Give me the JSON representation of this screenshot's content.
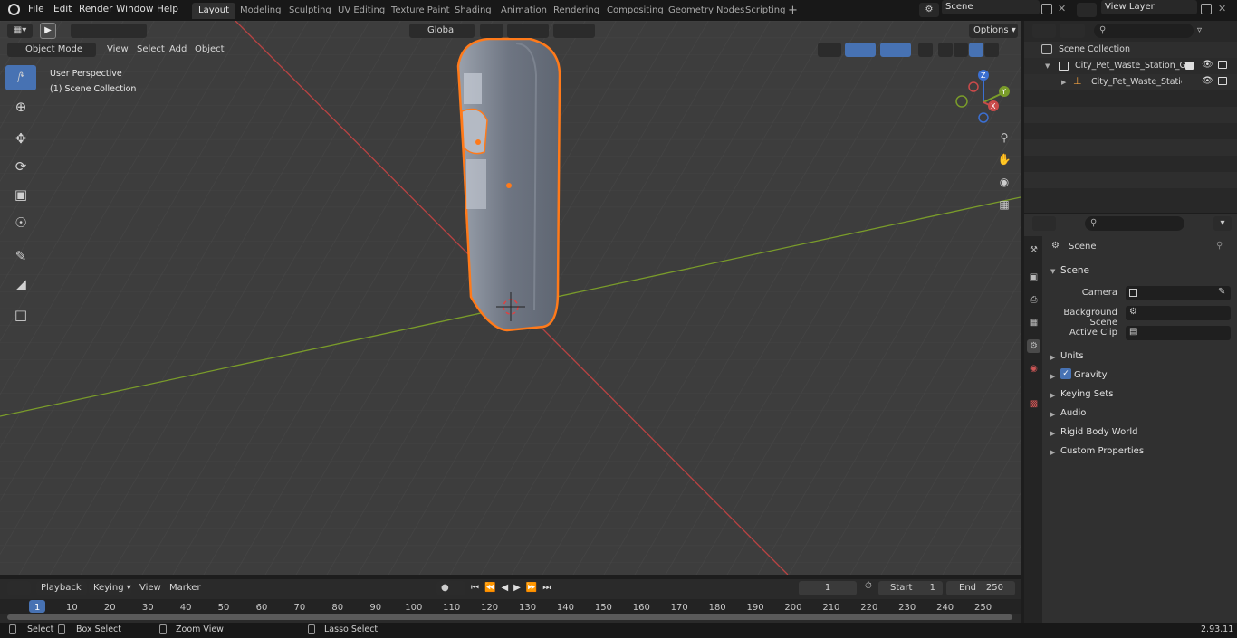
{
  "app": {
    "version": "2.93.11"
  },
  "menu": [
    "File",
    "Edit",
    "Render",
    "Window",
    "Help"
  ],
  "workspaces": [
    "Layout",
    "Modeling",
    "Sculpting",
    "UV Editing",
    "Texture Paint",
    "Shading",
    "Animation",
    "Rendering",
    "Compositing",
    "Geometry Nodes",
    "Scripting"
  ],
  "active_workspace": "Layout",
  "scene_field": "Scene",
  "view_layer_field": "View Layer",
  "viewport": {
    "mode": "Object Mode",
    "menus": [
      "View",
      "Select",
      "Add",
      "Object"
    ],
    "transform_orientation": "Global",
    "options": "Options",
    "overlay_title": "User Perspective",
    "overlay_collection": "(1) Scene Collection",
    "gizmo": {
      "x": "X",
      "y": "Y",
      "z": "Z"
    }
  },
  "outliner": {
    "root": "Scene Collection",
    "items": [
      "City_Pet_Waste_Station_Glass",
      "City_Pet_Waste_Station_"
    ]
  },
  "properties": {
    "header": "Scene",
    "panel": "Scene",
    "fields": {
      "camera": "Camera",
      "background_scene": "Background Scene",
      "active_clip": "Active Clip"
    },
    "sections": [
      "Units",
      "Gravity",
      "Keying Sets",
      "Audio",
      "Rigid Body World",
      "Custom Properties"
    ],
    "gravity_checked": true
  },
  "timeline": {
    "menus": [
      "Playback",
      "Keying",
      "View",
      "Marker"
    ],
    "current_frame": "1",
    "start_label": "Start",
    "start": "1",
    "end_label": "End",
    "end": "250",
    "ruler": [
      "1",
      "10",
      "20",
      "30",
      "40",
      "50",
      "60",
      "70",
      "80",
      "90",
      "100",
      "110",
      "120",
      "130",
      "140",
      "150",
      "160",
      "170",
      "180",
      "190",
      "200",
      "210",
      "220",
      "230",
      "240",
      "250"
    ]
  },
  "status": {
    "select": "Select",
    "box_select": "Box Select",
    "zoom_view": "Zoom View",
    "lasso_select": "Lasso Select"
  },
  "colors": {
    "accent": "#4772b3",
    "selection": "#ff7a1a",
    "x_axis": "#c94a4a",
    "y_axis": "#7a9c2a"
  }
}
